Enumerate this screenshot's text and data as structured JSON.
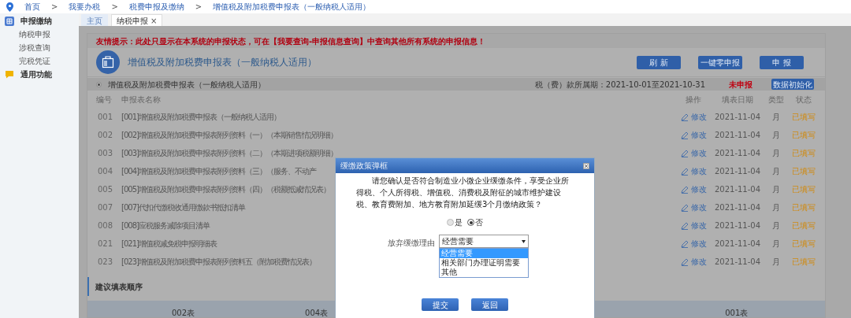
{
  "breadcrumb": {
    "separator": ">",
    "items": [
      "首页",
      "我要办税",
      "税费申报及缴纳",
      "增值税及附加税费申报表（一般纳税人适用）"
    ]
  },
  "sidebar": {
    "groups": [
      {
        "label": "申报缴纳",
        "kind": "grid",
        "items": [
          {
            "label": "纳税申报",
            "selected": false
          },
          {
            "label": "涉税查询",
            "selected": false
          },
          {
            "label": "完税凭证",
            "selected": false
          }
        ]
      },
      {
        "label": "通用功能",
        "kind": "chat"
      }
    ]
  },
  "tabs": [
    {
      "label": "主页",
      "selected": false,
      "closable": false
    },
    {
      "label": "纳税申报",
      "selected": true,
      "closable": true
    }
  ],
  "tab_close": "×",
  "notice": "友情提示：此处只显示在本系统的申报状态，可在【我要查询-申报信息查询】中查询其他所有系统的申报信息！",
  "form_title": "增值税及附加税费申报表（一般纳税人适用）",
  "buttons": [
    "刷 新",
    "一键零申报",
    "申 报"
  ],
  "declaration": {
    "title": "增值税及附加税费申报表（一般纳税人适用）",
    "selected": true,
    "period": "税（费）款所属期：2021-10-01至2021-10-31",
    "status": "未申报",
    "init_button": "数据初始化"
  },
  "table": {
    "columns": [
      "编号",
      "申报表名称",
      "操作",
      "填表日期",
      "类型",
      "状态"
    ],
    "rows": [
      {
        "code": "001",
        "name": "[001]增值税及附加税费申报表（一般纳税人适用）",
        "action": "修改",
        "date": "2021-11-04",
        "type": "月",
        "status": "已填写"
      },
      {
        "code": "002",
        "name": "[002]增值税及附加税费申报表附列资料（一）（本期销售情况明细）",
        "action": "修改",
        "date": "2021-11-04",
        "type": "月",
        "status": "已填写"
      },
      {
        "code": "003",
        "name": "[003]增值税及附加税费申报表附列资料（二）（本期进项税额明细）",
        "action": "修改",
        "date": "2021-11-04",
        "type": "月",
        "status": "已填写"
      },
      {
        "code": "004",
        "name": "[004]增值税及附加税费申报表附列资料（三）（服务、不动产",
        "action": "修改",
        "date": "2021-11-04",
        "type": "月",
        "status": "已填写"
      },
      {
        "code": "005",
        "name": "[005]增值税及附加税费申报表附列资料（四）（税额抵减情况表）",
        "action": "修改",
        "date": "2021-11-04",
        "type": "月",
        "status": "已填写"
      },
      {
        "code": "007",
        "name": "[007]代扣代缴税收通用缴款书抵扣清单",
        "action": "修改",
        "date": "2021-11-04",
        "type": "月",
        "status": "已填写"
      },
      {
        "code": "008",
        "name": "[008]应税服务减除项目清单",
        "action": "修改",
        "date": "2021-11-04",
        "type": "月",
        "status": "已填写"
      },
      {
        "code": "021",
        "name": "[021]增值税减免税申报明细表",
        "action": "修改",
        "date": "2021-11-04",
        "type": "月",
        "status": "已填写"
      },
      {
        "code": "023",
        "name": "[023]增值税及附加税费申报表附列资料五（附加税费情况表）",
        "action": "修改",
        "date": "2021-11-04",
        "type": "月",
        "status": "已填写"
      }
    ]
  },
  "order_section": {
    "title": "建议填表顺序",
    "steps": [
      "002表",
      "004表",
      "001表"
    ]
  },
  "dialog": {
    "title": "缓缴政策弹框",
    "question": "请您确认是否符合制造业小微企业缓缴条件，享受企业所得税、个人所得税、增值税、消费税及附征的城市维护建设税、教育费附加、地方教育附加延缓3个月缴纳政策？",
    "options": [
      {
        "label": "是",
        "selected": false
      },
      {
        "label": "否",
        "selected": true
      }
    ],
    "reason_label": "放弃缓缴理由",
    "select_value": "经营需要",
    "dropdown_options": [
      {
        "label": "经营需要",
        "selected": true
      },
      {
        "label": "相关部门办理证明需要",
        "selected": false
      },
      {
        "label": "其他",
        "selected": false
      }
    ],
    "buttons": [
      "提交",
      "返回"
    ]
  }
}
